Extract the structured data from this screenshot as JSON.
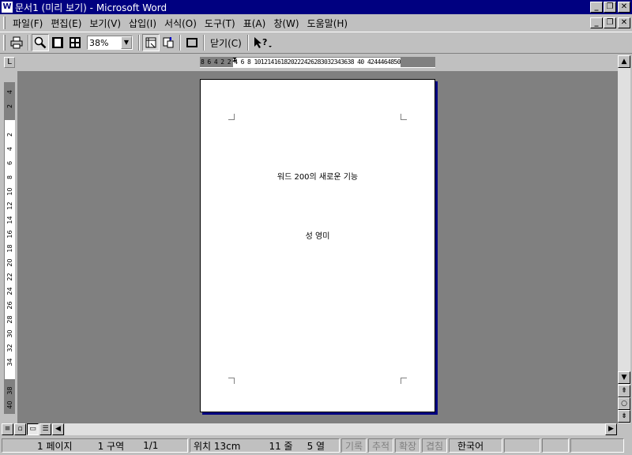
{
  "window": {
    "title": "문서1 (미리 보기) - Microsoft Word",
    "min_label": "_",
    "restore_label": "❐",
    "close_label": "✕"
  },
  "menu": {
    "items": [
      "파일(F)",
      "편집(E)",
      "보기(V)",
      "삽입(I)",
      "서식(O)",
      "도구(T)",
      "표(A)",
      "창(W)",
      "도움말(H)"
    ]
  },
  "toolbar": {
    "zoom_value": "38%",
    "close_label": "닫기(C)",
    "icons": [
      "print-icon",
      "magnifier-icon",
      "one-page-icon",
      "multiple-pages-icon",
      "view-ruler-icon",
      "shrink-to-fit-icon",
      "full-screen-icon",
      "context-help-icon"
    ]
  },
  "ruler": {
    "corner_label": "L",
    "horizontal_ticks": "8 6 4 2  2 4 6 8 101214161820222426283032343638 40 4244464850",
    "vertical_labels": [
      "4",
      "2",
      "2",
      "4",
      "6",
      "8",
      "10",
      "12",
      "14",
      "16",
      "18",
      "20",
      "22",
      "24",
      "26",
      "28",
      "30",
      "32",
      "34",
      "38",
      "40"
    ]
  },
  "document": {
    "title": "워드 200의 새로운 기능",
    "author": "성 영미"
  },
  "statusbar": {
    "page": "1 페이지",
    "section": "1 구역",
    "page_count": "1/1",
    "position": "위치 13cm",
    "line": "11 줄",
    "column": "5 열",
    "rec": "기록",
    "trk": "추적",
    "ext": "확장",
    "ovr": "겹침",
    "language": "한국어"
  },
  "colors": {
    "titlebar": "#000080",
    "chrome": "#c0c0c0",
    "workspace": "#808080"
  }
}
